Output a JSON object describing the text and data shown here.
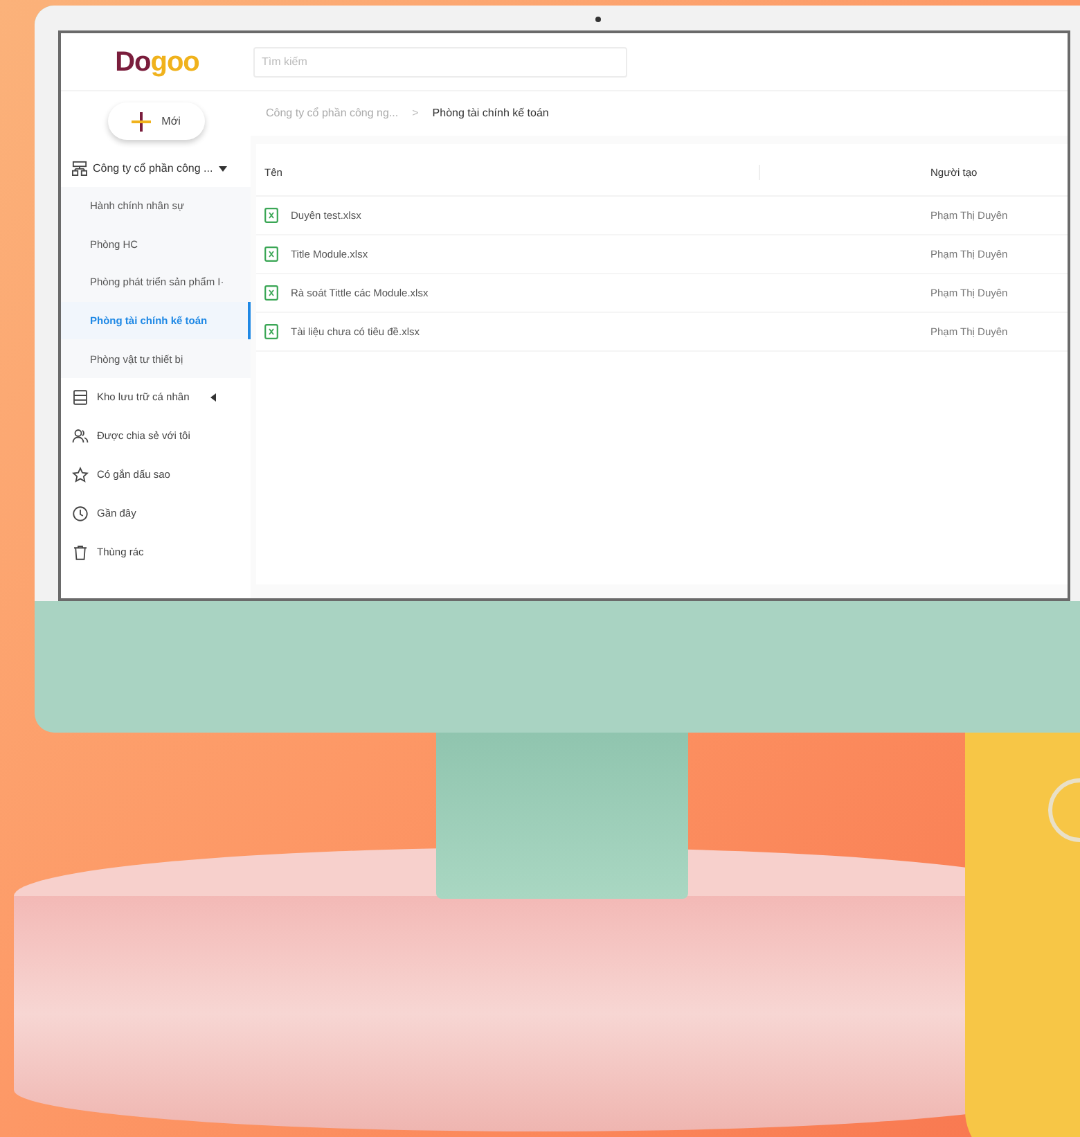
{
  "logo": {
    "parts": [
      {
        "text": "Do",
        "color": "#7a1d3c"
      },
      {
        "text": "goo",
        "color": "#f0b21c"
      }
    ]
  },
  "search": {
    "placeholder": "Tìm kiếm"
  },
  "new_button": {
    "label": "Mới"
  },
  "sidebar": {
    "tree": {
      "label": "Công ty cổ phần công ...",
      "expanded": true,
      "children": [
        {
          "label": "Hành chính nhân sự",
          "selected": false
        },
        {
          "label": "Phòng HC",
          "selected": false
        },
        {
          "label": "Phòng phát triển sản phẩm I·",
          "selected": false
        },
        {
          "label": "Phòng tài chính kế toán",
          "selected": true
        },
        {
          "label": "Phòng vật tư thiết bị",
          "selected": false
        }
      ]
    },
    "items": [
      {
        "label": "Kho lưu trữ cá nhân",
        "kind": "storage",
        "expanded": false
      },
      {
        "label": "Được chia sẻ với tôi",
        "kind": "shared"
      },
      {
        "label": "Có gắn dấu sao",
        "kind": "starred"
      },
      {
        "label": "Gần đây",
        "kind": "recent"
      },
      {
        "label": "Thùng rác",
        "kind": "trash"
      }
    ]
  },
  "breadcrumb": [
    "Công ty cổ phần công ng...",
    "Phòng tài chính kế toán"
  ],
  "breadcrumb_separator": ">",
  "table": {
    "columns": [
      "Tên",
      "Người tạo"
    ],
    "rows": [
      {
        "name": "Duyên test.xlsx",
        "creator": "Phạm Thị Duyên"
      },
      {
        "name": "Title Module.xlsx",
        "creator": "Phạm Thị Duyên"
      },
      {
        "name": "Rà soát Tittle các Module.xlsx",
        "creator": "Phạm Thị Duyên"
      },
      {
        "name": "Tài liệu chưa có tiêu đề.xlsx",
        "creator": "Phạm Thị Duyên"
      }
    ]
  }
}
